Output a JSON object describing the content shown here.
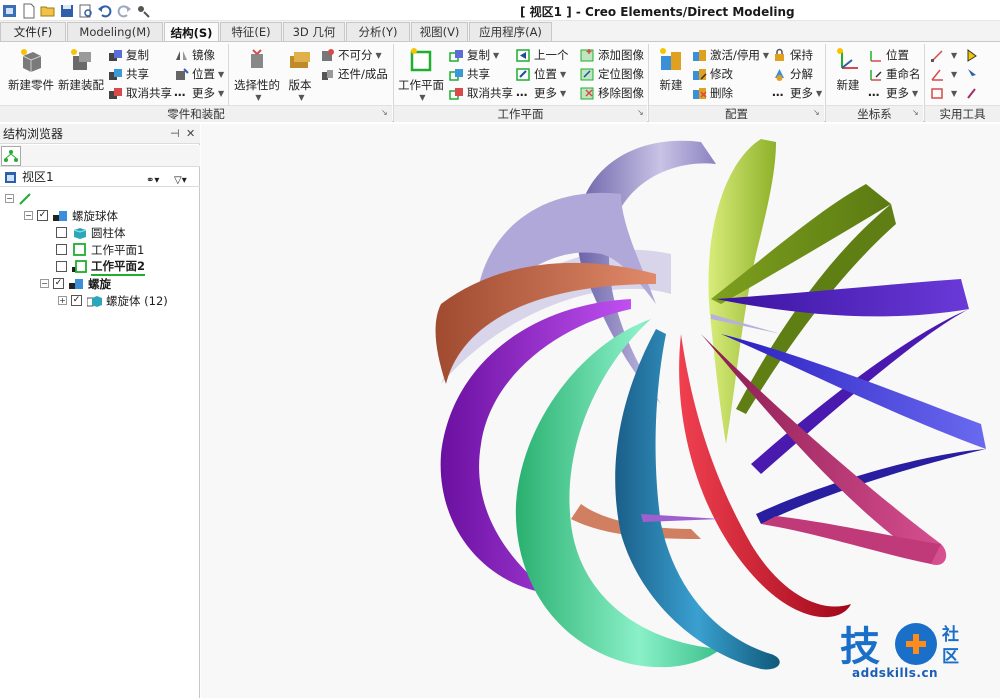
{
  "window": {
    "title": "[ 视区1 ] - Creo Elements/Direct Modeling"
  },
  "quick_access": {
    "icons": [
      "app-icon",
      "new-file-icon",
      "open-folder-icon",
      "save-icon",
      "print-preview-icon",
      "undo-icon",
      "redo-icon",
      "customize-icon"
    ]
  },
  "tabs": [
    {
      "label": "文件(F)",
      "active": false
    },
    {
      "label": "Modeling(M)",
      "active": false
    },
    {
      "label": "结构(S)",
      "active": true
    },
    {
      "label": "特征(E)",
      "active": false
    },
    {
      "label": "3D 几何",
      "active": false
    },
    {
      "label": "分析(Y)",
      "active": false
    },
    {
      "label": "视图(V)",
      "active": false
    },
    {
      "label": "应用程序(A)",
      "active": false
    }
  ],
  "ribbon": {
    "groups": {
      "parts": {
        "label": "零件和装配",
        "new_part": "新建零件",
        "new_assembly": "新建装配",
        "copy": "复制",
        "share": "共享",
        "unshare": "取消共享",
        "mirror": "镜像",
        "position": "位置",
        "more": "更多",
        "selective": "选择性的",
        "version": "版本",
        "unavailable": "不可分",
        "restore": "还件/成品"
      },
      "workplane": {
        "label": "工作平面",
        "workplane": "工作平面",
        "copy": "复制",
        "share": "共享",
        "unshare": "取消共享",
        "prev": "上一个",
        "position": "位置",
        "more": "更多",
        "add_image": "添加图像",
        "locate_image": "定位图像",
        "remove_image": "移除图像"
      },
      "config": {
        "label": "配置",
        "new": "新建",
        "activate": "激活/停用",
        "modify": "修改",
        "delete": "删除",
        "keep": "保持",
        "decompose": "分解",
        "more": "更多"
      },
      "coordsys": {
        "label": "坐标系",
        "new": "新建",
        "position": "位置",
        "rename": "重命名",
        "more": "更多"
      },
      "tools": {
        "label": "实用工具"
      }
    }
  },
  "browser": {
    "title": "结构浏览器",
    "view_label": "视区1",
    "tree": [
      {
        "label": "",
        "level": 0,
        "checked": false,
        "icon": "root-line-icon"
      },
      {
        "label": "螺旋球体",
        "level": 1,
        "checked": true,
        "icon": "assembly-icon"
      },
      {
        "label": "圆柱体",
        "level": 2,
        "checked": false,
        "icon": "part-icon"
      },
      {
        "label": "工作平面1",
        "level": 2,
        "checked": false,
        "icon": "workplane-icon"
      },
      {
        "label": "工作平面2",
        "level": 2,
        "checked": false,
        "icon": "workplane-icon"
      },
      {
        "label": "螺旋",
        "level": 1,
        "checked": true,
        "icon": "assembly-icon"
      },
      {
        "label": "螺旋体 (12)",
        "level": 2,
        "checked": true,
        "icon": "part-group-icon"
      }
    ]
  },
  "viewport": {
    "model": "helical-sphere-ribbons",
    "ribbon_colors": [
      "#8c85c2",
      "#6f8f1f",
      "#9fbf2e",
      "#4b1fa0",
      "#3a2ec8",
      "#2a1ea0",
      "#b03070",
      "#d0102a",
      "#1f7fb0",
      "#30c080",
      "#8a20c0",
      "#c06a4a",
      "#c8c2e0"
    ]
  },
  "watermark": {
    "logo_text": "技社区",
    "site": "addskills.cn"
  }
}
